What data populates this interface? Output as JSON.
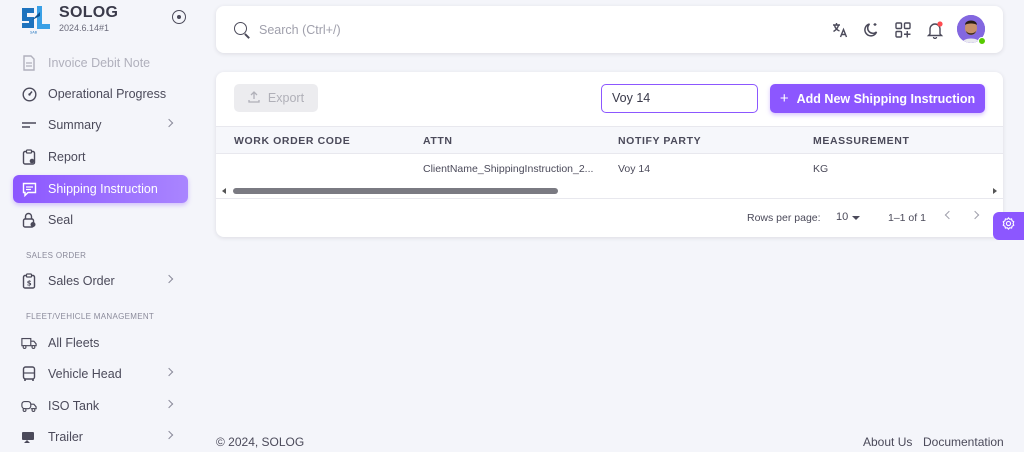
{
  "brand": {
    "name": "SOLOG",
    "version": "2024.6.14#1"
  },
  "nav": {
    "items": [
      {
        "label": "Invoice Debit Note",
        "icon": "document-icon",
        "disabled": true
      },
      {
        "label": "Operational Progress",
        "icon": "gauge-icon"
      },
      {
        "label": "Summary",
        "icon": "lines-icon",
        "chevron": true
      },
      {
        "label": "Report",
        "icon": "clipboard-icon"
      },
      {
        "label": "Shipping Instruction",
        "icon": "message-icon",
        "active": true
      },
      {
        "label": "Seal",
        "icon": "lock-icon"
      }
    ],
    "sections": [
      {
        "label": "SALES ORDER"
      },
      {
        "label": "FLEET/VEHICLE MANAGEMENT"
      }
    ],
    "sales_items": [
      {
        "label": "Sales Order",
        "icon": "dollar-doc-icon",
        "chevron": true
      }
    ],
    "fleet_items": [
      {
        "label": "All Fleets",
        "icon": "truck-icon"
      },
      {
        "label": "Vehicle Head",
        "icon": "bus-icon",
        "chevron": true
      },
      {
        "label": "ISO Tank",
        "icon": "tank-truck-icon",
        "chevron": true
      },
      {
        "label": "Trailer",
        "icon": "trailer-icon",
        "chevron": true
      }
    ]
  },
  "topbar": {
    "search_placeholder": "Search (Ctrl+/)",
    "icons": [
      "translate-icon",
      "moon-star-icon",
      "apps-icon",
      "bell-icon",
      "avatar"
    ]
  },
  "toolbar": {
    "export_label": "Export",
    "search_value": "Voy 14",
    "add_label": "Add New Shipping Instruction"
  },
  "table": {
    "columns": [
      "WORK ORDER CODE",
      "ATTN",
      "NOTIFY PARTY",
      "MEASSUREMENT"
    ],
    "rows": [
      [
        "",
        "ClientName_ShippingInstruction_2...",
        "Voy 14",
        "KG"
      ]
    ]
  },
  "pagination": {
    "rows_per_page_label": "Rows per page:",
    "rows_per_page_value": "10",
    "range": "1–1 of 1"
  },
  "footer": {
    "copyright": "© 2024, SOLOG",
    "links": [
      "About Us",
      "Documentation"
    ]
  },
  "colors": {
    "primary": "#8c57ff",
    "background": "#f4f5fa",
    "status_online": "#56ca00",
    "notification": "#ff4c51"
  }
}
